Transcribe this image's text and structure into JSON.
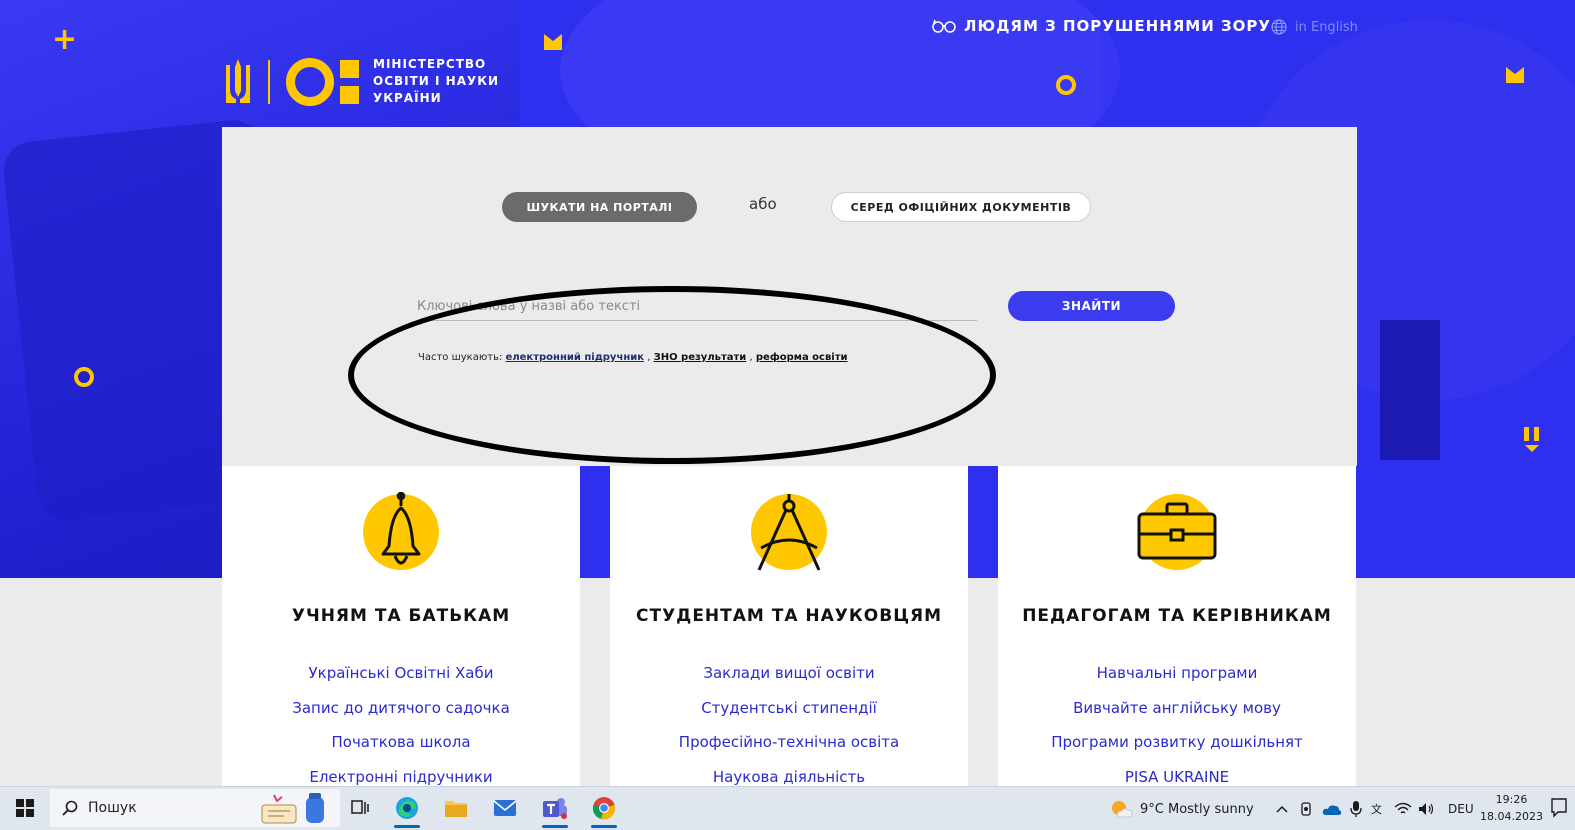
{
  "header": {
    "logo_line1": "МІНІСТЕРСТВО",
    "logo_line2": "ОСВІТИ І НАУКИ",
    "logo_line3": "УКРАЇНИ",
    "vision_label": "ЛЮДЯМ З ПОРУШЕННЯМИ ЗОРУ",
    "lang_label": "in English"
  },
  "search": {
    "tab_portal": "ШУКАТИ НА ПОРТАЛІ",
    "or_label": "або",
    "tab_docs": "СЕРЕД ОФІЦІЙНИХ ДОКУМЕНТІВ",
    "placeholder": "Ключові слова у назві або тексті",
    "find_label": "ЗНАЙТИ",
    "frequent_label": "Часто шукають:",
    "frequent_links": [
      "електронний підручник",
      "ЗНО результати",
      "реформа освіти"
    ]
  },
  "cards": [
    {
      "title": "УЧНЯМ ТА БАТЬКАМ",
      "icon": "bell-icon",
      "links": [
        "Українські Освітні Хаби",
        "Запис до дитячого садочка",
        "Початкова школа",
        "Електронні підручники"
      ]
    },
    {
      "title": "СТУДЕНТАМ ТА НАУКОВЦЯМ",
      "icon": "compass-icon",
      "links": [
        "Заклади вищої освіти",
        "Студентські стипендії",
        "Професійно-технічна освіта",
        "Наукова діяльність"
      ]
    },
    {
      "title": "ПЕДАГОГАМ ТА КЕРІВНИКАМ",
      "icon": "briefcase-icon",
      "links": [
        "Навчальні програми",
        "Вивчайте англійську мову",
        "Програми розвитку дошкільнят",
        "PISA UKRAINE"
      ]
    }
  ],
  "taskbar": {
    "search_label": "Пошук",
    "weather": "9°C  Mostly sunny",
    "lang": "DEU",
    "time": "19:26",
    "date": "18.04.2023"
  },
  "colors": {
    "brand_blue": "#2f2ff0",
    "accent_yellow": "#ffc700",
    "link_blue": "#2a2ad0"
  }
}
